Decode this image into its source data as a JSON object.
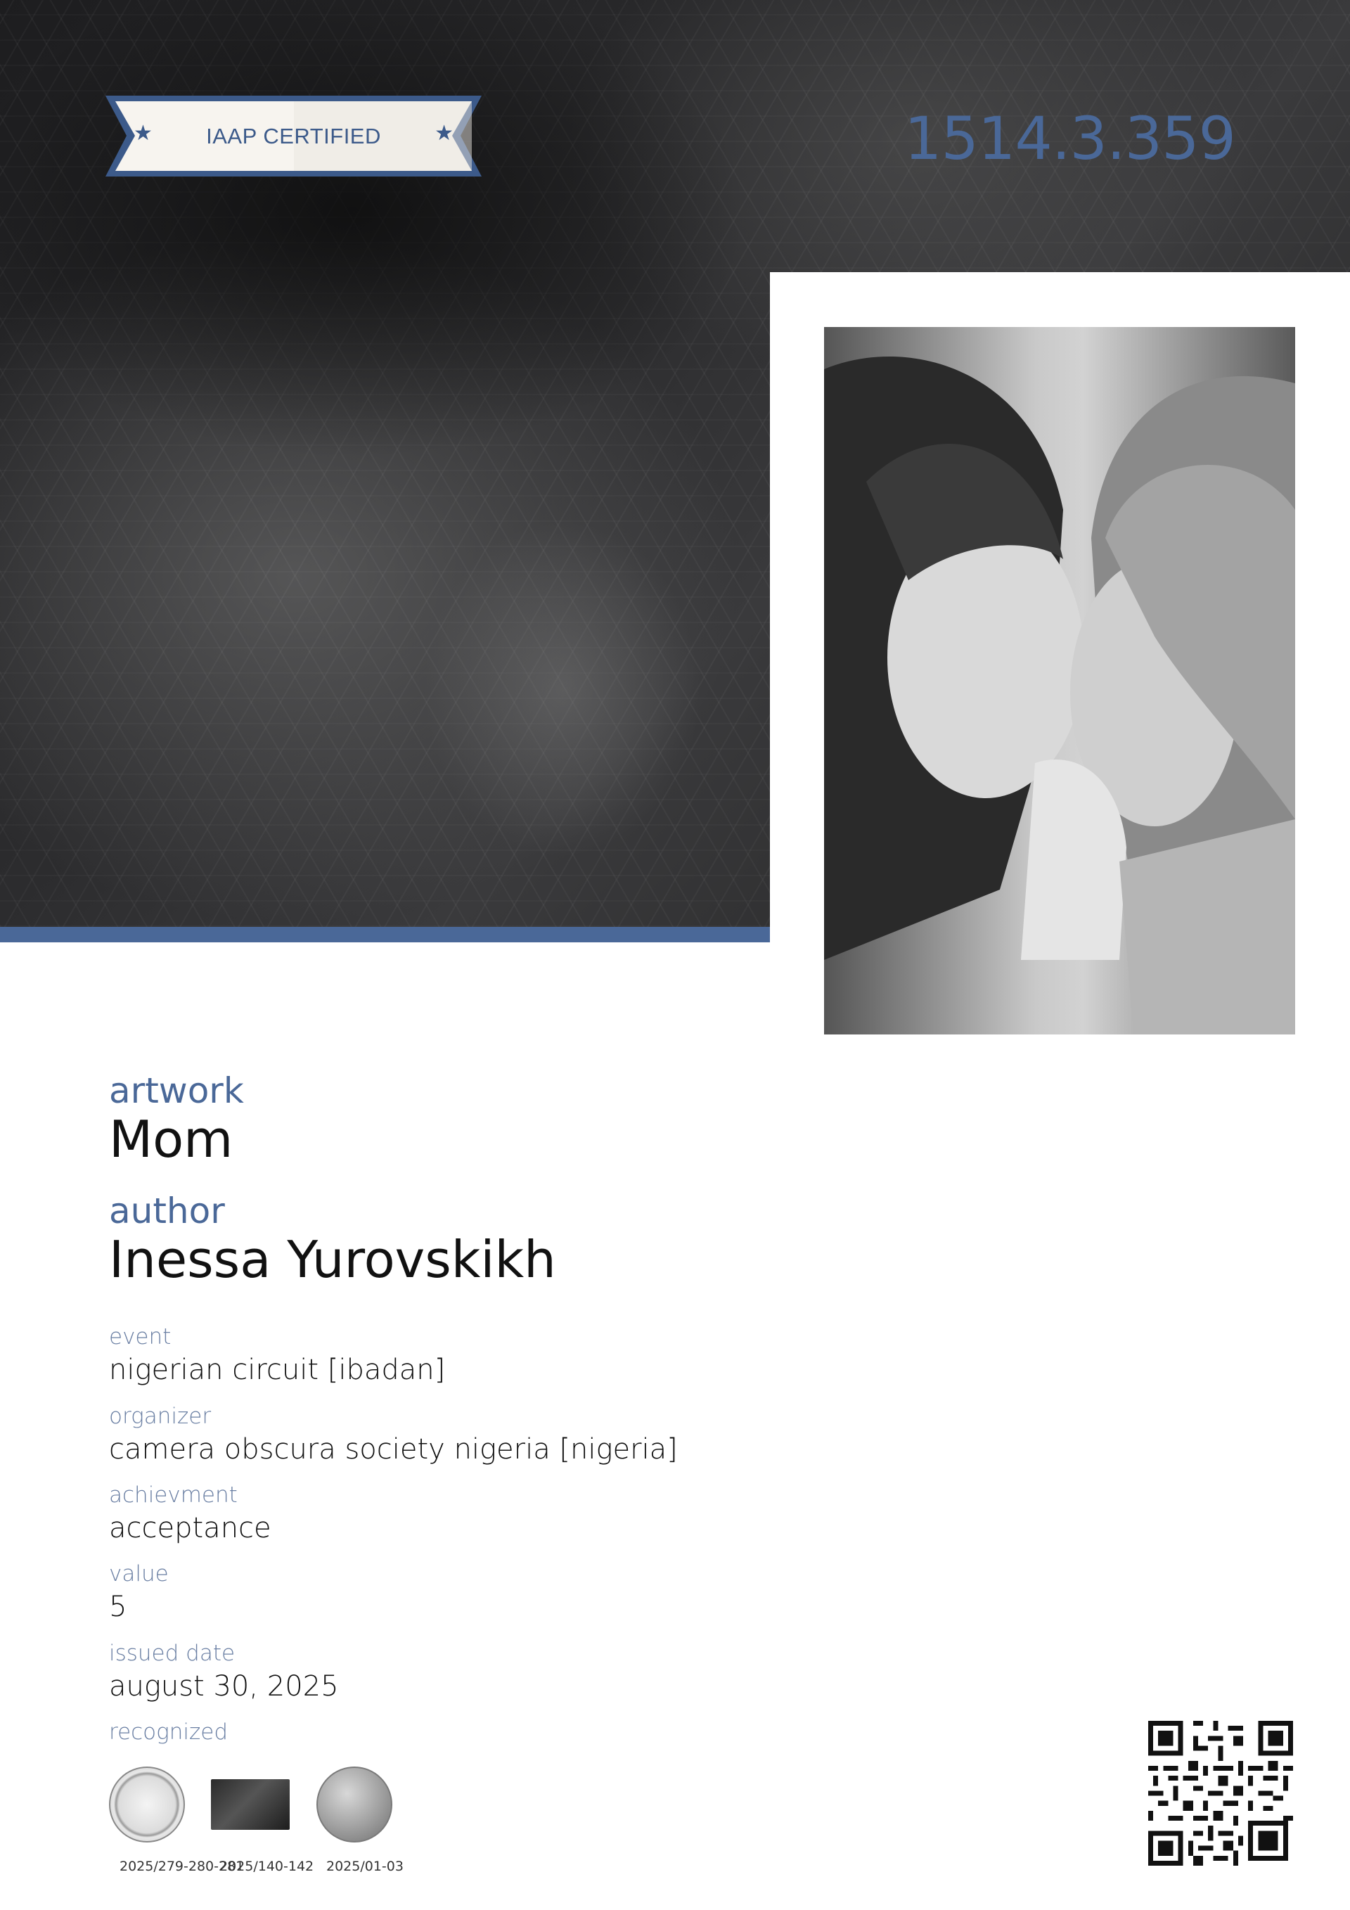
{
  "badge": {
    "label": "IAAP CERTIFIED"
  },
  "certificate": {
    "number": "1514.3.359"
  },
  "artwork": {
    "label": "artwork",
    "value": "Mom"
  },
  "author": {
    "label": "author",
    "value": "Inessa Yurovskikh"
  },
  "details": [
    {
      "label": "event",
      "value": "nigerian circuit [ibadan]"
    },
    {
      "label": "organizer",
      "value": "camera obscura society nigeria [nigeria]"
    },
    {
      "label": "achievment",
      "value": "acceptance"
    },
    {
      "label": "value",
      "value": "5"
    },
    {
      "label": "issued date",
      "value": "august 30, 2025"
    }
  ],
  "recognized": {
    "label": "recognized",
    "refs": [
      "2025/279-280-281",
      "2025/140-142",
      "2025/01-03"
    ]
  },
  "colors": {
    "accent": "#4a6898",
    "hero_dark": "#2a2a2c",
    "text": "#111111"
  },
  "icons": {
    "ribbon_star": "star-icon",
    "qr": "qr-code-icon"
  }
}
